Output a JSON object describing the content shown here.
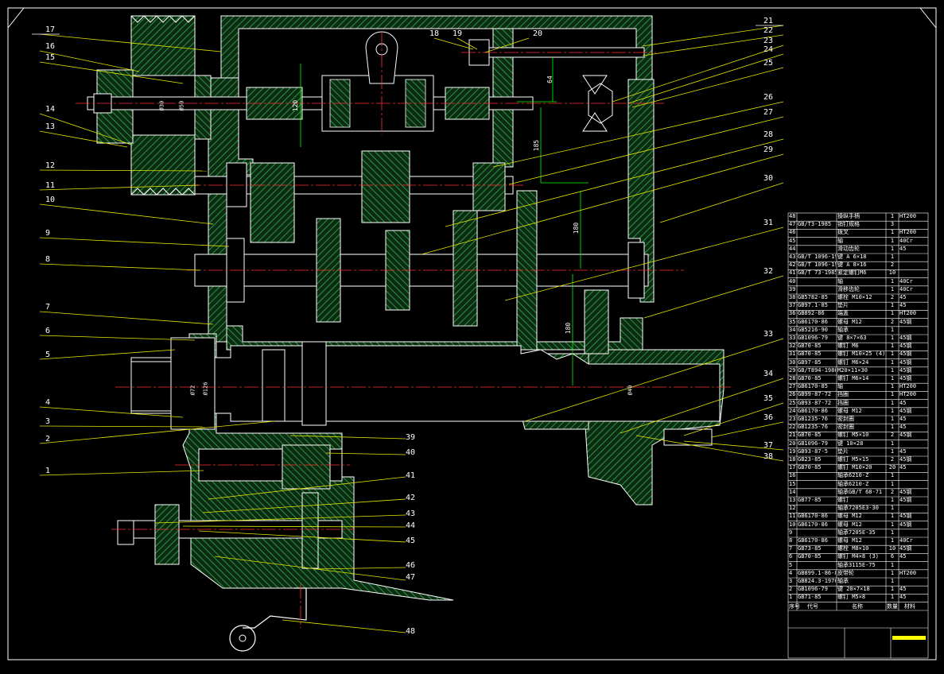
{
  "colors": {
    "background": "#000000",
    "outline": "#ffffff",
    "hatch": "#1f9a3a",
    "centerline": "#ff3030",
    "leader": "#ffff00",
    "dimension": "#00ff00",
    "title_accent": "#ffff00"
  },
  "balloons": {
    "left": [
      "17",
      "16",
      "15",
      "14",
      "13",
      "12",
      "11",
      "10",
      "9",
      "8",
      "7",
      "6",
      "5",
      "4",
      "3",
      "2",
      "1"
    ],
    "right": [
      "21",
      "22",
      "23",
      "24",
      "25",
      "26",
      "27",
      "28",
      "29",
      "30",
      "31",
      "32",
      "33",
      "34",
      "35",
      "36",
      "37",
      "38"
    ],
    "bottom": [
      "39",
      "40",
      "41",
      "42",
      "43",
      "44",
      "45",
      "46",
      "47",
      "48"
    ],
    "top": [
      "18",
      "19",
      "20"
    ]
  },
  "dimensions": {
    "top_small": "64",
    "mid_185": "185",
    "mid_180": "180",
    "mid_120": "120",
    "low_180": "180",
    "bore_a": "Ø72",
    "bore_b": "Ø126",
    "bore_c": "Ø40",
    "shaft_a": "Ø50",
    "shaft_b": "Ø30"
  },
  "bom": {
    "headers": {
      "no": "序号",
      "code": "代号",
      "name": "名称",
      "qty": "数量",
      "mat": "材料"
    },
    "rows": [
      {
        "no": "48",
        "code": "",
        "name": "操纵手柄",
        "qty": "1",
        "mat": "HT200"
      },
      {
        "no": "47",
        "code": "GB/T3-1985",
        "name": "销钉规格",
        "qty": "3",
        "mat": ""
      },
      {
        "no": "46",
        "code": "",
        "name": "拨叉",
        "qty": "1",
        "mat": "HT200"
      },
      {
        "no": "45",
        "code": "",
        "name": "轴",
        "qty": "1",
        "mat": "40Cr"
      },
      {
        "no": "44",
        "code": "",
        "name": "滑动齿轮",
        "qty": "1",
        "mat": "45"
      },
      {
        "no": "43",
        "code": "GB/T 1096-1979",
        "name": "键 A 6×18",
        "qty": "1",
        "mat": ""
      },
      {
        "no": "42",
        "code": "GB/T 1096-1979",
        "name": "键 A 8×16",
        "qty": "2",
        "mat": ""
      },
      {
        "no": "41",
        "code": "GB/T 73-1985",
        "name": "紧定螺钉M6",
        "qty": "10",
        "mat": ""
      },
      {
        "no": "40",
        "code": "",
        "name": "轴",
        "qty": "1",
        "mat": "40Cr"
      },
      {
        "no": "39",
        "code": "",
        "name": "滑移齿轮",
        "qty": "1",
        "mat": "40Cr"
      },
      {
        "no": "38",
        "code": "GB5782-85",
        "name": "螺栓 M10×12",
        "qty": "2",
        "mat": "45"
      },
      {
        "no": "37",
        "code": "GB97.1-85",
        "name": "垫片",
        "qty": "1",
        "mat": "45"
      },
      {
        "no": "36",
        "code": "GB892-86",
        "name": "端盖",
        "qty": "1",
        "mat": "HT200"
      },
      {
        "no": "35",
        "code": "GB6170-86",
        "name": "螺母 M12",
        "qty": "2",
        "mat": "45钢"
      },
      {
        "no": "34",
        "code": "GB5216-90",
        "name": "轴承",
        "qty": "1",
        "mat": ""
      },
      {
        "no": "33",
        "code": "GB1096-79",
        "name": "键 8×7×63",
        "qty": "1",
        "mat": "45钢"
      },
      {
        "no": "32",
        "code": "GB70-85",
        "name": "螺钉 M6",
        "qty": "1",
        "mat": "45钢"
      },
      {
        "no": "31",
        "code": "GB70-85",
        "name": "螺钉 M10×25 (4)",
        "qty": "1",
        "mat": "45钢"
      },
      {
        "no": "30",
        "code": "GB97-85",
        "name": "螺钉 M6×24",
        "qty": "1",
        "mat": "45钢"
      },
      {
        "no": "29",
        "code": "GB/T894-1986",
        "name": "M20×11×30",
        "qty": "1",
        "mat": "45钢"
      },
      {
        "no": "28",
        "code": "GB70-85",
        "name": "螺钉 M6×14",
        "qty": "1",
        "mat": "45钢"
      },
      {
        "no": "27",
        "code": "GB6170-85",
        "name": "轴",
        "qty": "1",
        "mat": "HT200"
      },
      {
        "no": "26",
        "code": "GB99-87-72",
        "name": "挡圈",
        "qty": "1",
        "mat": "HT200"
      },
      {
        "no": "25",
        "code": "GB93-87-72",
        "name": "挡圈",
        "qty": "1",
        "mat": "45"
      },
      {
        "no": "24",
        "code": "GB6170-86",
        "name": "螺母 M12",
        "qty": "1",
        "mat": "45钢"
      },
      {
        "no": "23",
        "code": "GB1235-76",
        "name": "密封圈",
        "qty": "1",
        "mat": "45"
      },
      {
        "no": "22",
        "code": "GB1235-76",
        "name": "密封圈",
        "qty": "1",
        "mat": "45"
      },
      {
        "no": "21",
        "code": "GB70-85",
        "name": "螺钉 M5×10",
        "qty": "2",
        "mat": "45钢"
      },
      {
        "no": "20",
        "code": "GB1096-79",
        "name": "键 10×28",
        "qty": "1",
        "mat": ""
      },
      {
        "no": "19",
        "code": "GB93-87-5",
        "name": "垫片",
        "qty": "1",
        "mat": "45"
      },
      {
        "no": "18",
        "code": "GB23-85",
        "name": "螺钉 M5×15",
        "qty": "2",
        "mat": "45钢"
      },
      {
        "no": "17",
        "code": "GB70-85",
        "name": "螺钉 M10×20",
        "qty": "20",
        "mat": "45"
      },
      {
        "no": "16",
        "code": "",
        "name": "轴承6210-Z",
        "qty": "1",
        "mat": ""
      },
      {
        "no": "15",
        "code": "",
        "name": "轴承6210-Z",
        "qty": "1",
        "mat": ""
      },
      {
        "no": "14",
        "code": "",
        "name": "轴承GB/T 68-71",
        "qty": "2",
        "mat": "45钢"
      },
      {
        "no": "13",
        "code": "GB77-85",
        "name": "螺钉",
        "qty": "1",
        "mat": "45钢"
      },
      {
        "no": "12",
        "code": "",
        "name": "轴承7205E3-30",
        "qty": "1",
        "mat": ""
      },
      {
        "no": "11",
        "code": "GB6170-86",
        "name": "螺母 M12",
        "qty": "1",
        "mat": "45钢"
      },
      {
        "no": "10",
        "code": "GB6170-86",
        "name": "螺母 M12",
        "qty": "1",
        "mat": "45钢"
      },
      {
        "no": "9",
        "code": "",
        "name": "轴承7205E-35",
        "qty": "1",
        "mat": ""
      },
      {
        "no": "8",
        "code": "GB6170-86",
        "name": "螺母 M12",
        "qty": "1",
        "mat": "40Cr"
      },
      {
        "no": "7",
        "code": "GB73-85",
        "name": "螺栓 M8×10",
        "qty": "10",
        "mat": "45钢"
      },
      {
        "no": "6",
        "code": "GB70-85",
        "name": "螺钉 M4×8 (3)",
        "qty": "6",
        "mat": "45"
      },
      {
        "no": "5",
        "code": "",
        "name": "轴承3115E-75",
        "qty": "1",
        "mat": ""
      },
      {
        "no": "4",
        "code": "GB899.1-86-80",
        "name": "皮带轮",
        "qty": "1",
        "mat": "HT200"
      },
      {
        "no": "3",
        "code": "GB824.3-1976",
        "name": "轴承",
        "qty": "1",
        "mat": ""
      },
      {
        "no": "2",
        "code": "GB1096-79",
        "name": "键 20×7×18",
        "qty": "1",
        "mat": "45"
      },
      {
        "no": "1",
        "code": "GB71-85",
        "name": "螺钉 M5×8",
        "qty": "1",
        "mat": "45"
      }
    ]
  }
}
